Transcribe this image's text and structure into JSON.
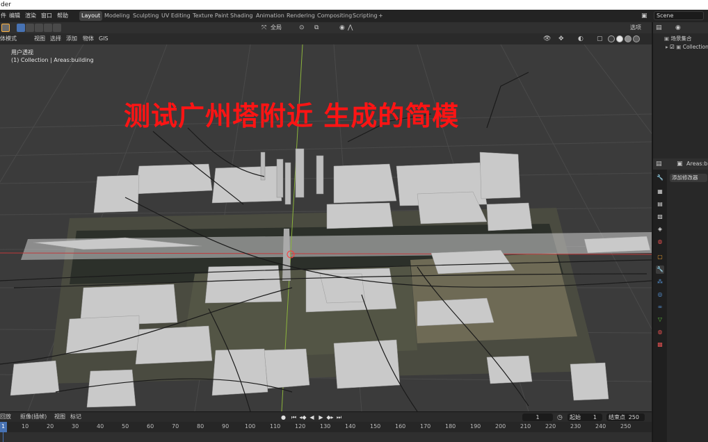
{
  "window": {
    "title_fragment": "der"
  },
  "menu": [
    "件",
    "编辑",
    "渲染",
    "窗口",
    "帮助"
  ],
  "workspaces": [
    "Layout",
    "Modeling",
    "Sculpting",
    "UV Editing",
    "Texture Paint",
    "Shading",
    "Animation",
    "Rendering",
    "Compositing",
    "Scripting",
    "+"
  ],
  "active_workspace": "Layout",
  "scene": {
    "name": "Scene"
  },
  "viewport_header": {
    "mode": "体模式",
    "menus": [
      "视图",
      "选择",
      "添加",
      "物体",
      "GIS"
    ],
    "transform_orientation": "全局",
    "options_label": "选项"
  },
  "viewport": {
    "view_name": "用户透视",
    "collection_info": "(1) Collection | Areas:building",
    "caption": "测试广州塔附近 生成的简模"
  },
  "outliner": {
    "root": "场景集合",
    "collection": "Collection"
  },
  "properties": {
    "object_name": "Areas:buildi",
    "add_modifier": "添加修改器"
  },
  "timeline": {
    "menus": [
      "回放",
      "抠像(插帧)",
      "视图",
      "标记"
    ],
    "current_frame": "1",
    "start_label": "起始",
    "start_frame": "1",
    "end_label": "结束点",
    "end_frame": "250",
    "ruler": [
      "1",
      "10",
      "20",
      "30",
      "40",
      "50",
      "60",
      "70",
      "80",
      "90",
      "100",
      "110",
      "120",
      "130",
      "140",
      "150",
      "160",
      "170",
      "180",
      "190",
      "200",
      "210",
      "220",
      "230",
      "240",
      "250"
    ]
  },
  "colors": {
    "accent_blue": "#4772b3",
    "caption_red": "#ff1414",
    "playhead": "#4772b3",
    "x_axis": "#c0393b",
    "y_axis": "#8cb43c"
  }
}
